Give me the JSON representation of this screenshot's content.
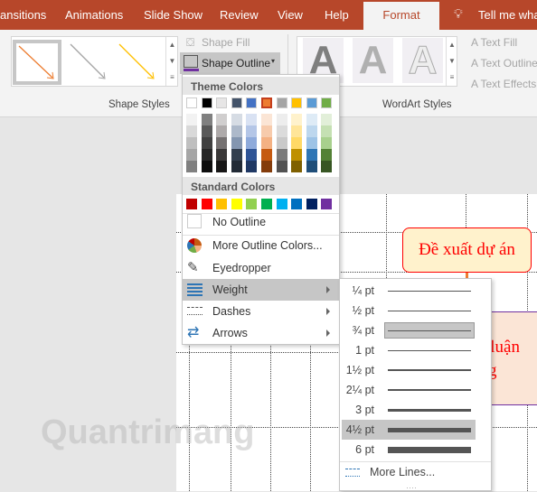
{
  "tabs": [
    "ansitions",
    "Animations",
    "Slide Show",
    "Review",
    "View",
    "Help",
    "Format",
    "Tell me wha"
  ],
  "active_tab": "Format",
  "ribbon": {
    "shape_fill": "Shape Fill",
    "shape_outline": "Shape Outline",
    "shape_styles_label": "Shape Styles",
    "wordart_label": "WordArt Styles",
    "text_fill": "Text Fill",
    "text_outline": "Text Outline",
    "text_effects": "Text Effects",
    "wordart_glyph": "A",
    "style_arrow_colors": [
      "#ed7d31",
      "#a5a5a5",
      "#ffc000"
    ]
  },
  "menu": {
    "theme_header": "Theme Colors",
    "theme_top": [
      "#ffffff",
      "#000000",
      "#e7e6e6",
      "#44546a",
      "#4472c4",
      "#ed7d31",
      "#a5a5a5",
      "#ffc000",
      "#5b9bd5",
      "#70ad47"
    ],
    "theme_shades": [
      [
        "#f2f2f2",
        "#d9d9d9",
        "#bfbfbf",
        "#a6a6a6",
        "#808080"
      ],
      [
        "#808080",
        "#595959",
        "#404040",
        "#262626",
        "#0d0d0d"
      ],
      [
        "#d0cece",
        "#aeaaaa",
        "#757171",
        "#3a3838",
        "#171616"
      ],
      [
        "#d6dce4",
        "#adb9ca",
        "#8496b0",
        "#333f4f",
        "#222a35"
      ],
      [
        "#d9e2f3",
        "#b4c6e7",
        "#8eaadb",
        "#2f5496",
        "#1f3864"
      ],
      [
        "#fbe5d5",
        "#f7cbac",
        "#f4b183",
        "#c55a11",
        "#843c0b"
      ],
      [
        "#ededed",
        "#dbdbdb",
        "#c9c9c9",
        "#7b7b7b",
        "#525252"
      ],
      [
        "#fff2cc",
        "#ffe599",
        "#ffd966",
        "#bf9000",
        "#7f6000"
      ],
      [
        "#deebf6",
        "#bdd7ee",
        "#9dc3e6",
        "#2e75b5",
        "#1f4e79"
      ],
      [
        "#e2efd9",
        "#c5e0b3",
        "#a8d08d",
        "#538135",
        "#375623"
      ]
    ],
    "standard_header": "Standard Colors",
    "standard": [
      "#c00000",
      "#ff0000",
      "#ffc000",
      "#ffff00",
      "#92d050",
      "#00b050",
      "#00b0f0",
      "#0070c0",
      "#002060",
      "#7030a0"
    ],
    "selected_color": "#ed7d31",
    "items": [
      {
        "label": "No Outline",
        "icon": "no-outline-swatch"
      },
      {
        "label": "More Outline Colors...",
        "icon": "color-wheel-icon"
      },
      {
        "label": "Eyedropper",
        "icon": "eyedropper-icon"
      },
      {
        "label": "Weight",
        "icon": "weight-icon",
        "submenu": true,
        "highlighted": true
      },
      {
        "label": "Dashes",
        "icon": "dashes-icon",
        "submenu": true
      },
      {
        "label": "Arrows",
        "icon": "arrows-icon",
        "submenu": true
      }
    ]
  },
  "weight": {
    "items": [
      {
        "label": "¼ pt",
        "pt": 0.25
      },
      {
        "label": "½ pt",
        "pt": 0.5
      },
      {
        "label": "¾ pt",
        "pt": 0.75
      },
      {
        "label": "1 pt",
        "pt": 1
      },
      {
        "label": "1½ pt",
        "pt": 1.5
      },
      {
        "label": "2¼ pt",
        "pt": 2.25
      },
      {
        "label": "3 pt",
        "pt": 3
      },
      {
        "label": "4½ pt",
        "pt": 4.5
      },
      {
        "label": "6 pt",
        "pt": 6
      }
    ],
    "current": "¾ pt",
    "hovered": "4½ pt",
    "more": "More Lines..."
  },
  "slide": {
    "box1": "Đề xuất dự án",
    "box2_line1": "o luận",
    "box2_line2": "g"
  },
  "watermark": "Quantrimang"
}
